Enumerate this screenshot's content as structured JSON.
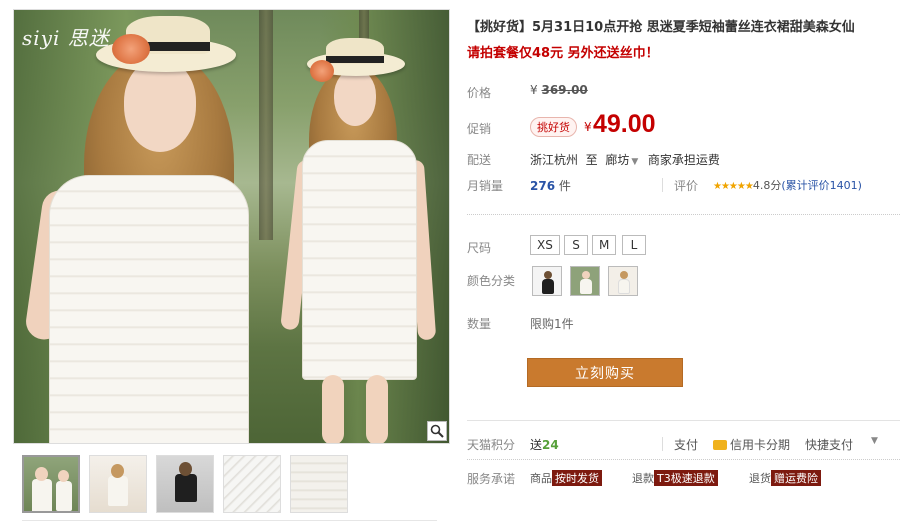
{
  "product": {
    "title": "【挑好货】5月31日10点开抢 思迷夏季短袖蕾丝连衣裙甜美森女仙",
    "subtitle": "请拍套餐仅48元 另外还送丝巾！",
    "brand_logo": "siyi 思迷"
  },
  "price": {
    "label": "价格",
    "currency": "¥",
    "original": "369.00",
    "promo_label": "促销",
    "promo_badge": "挑好货",
    "current": "49.00"
  },
  "shipping": {
    "label": "配送",
    "from": "浙江杭州",
    "to_word": "至",
    "to": "廊坊",
    "fee": "商家承担运费"
  },
  "sales": {
    "label": "月销量",
    "count": "276",
    "unit": "件",
    "rating_label": "评价",
    "stars": "★★★★★",
    "score": "4.8分",
    "review_link": "(累计评价1401)"
  },
  "options": {
    "size_label": "尺码",
    "sizes": [
      "XS",
      "S",
      "M",
      "L"
    ],
    "color_label": "颜色分类",
    "quantity_label": "数量",
    "quantity_limit": "限购1件"
  },
  "buy_button": "立刻购买",
  "footer": {
    "points_label": "天猫积分",
    "points_prefix": "送",
    "points": "24",
    "pay_label": "支付",
    "pay_method": "信用卡分期",
    "quick_pay": "快捷支付",
    "service_label": "服务承诺",
    "service_1_prefix": "商品",
    "service_1_tag": "按时发货",
    "service_2_prefix": "退款",
    "service_2_tag": "T3极速退款",
    "service_3_prefix": "退货",
    "service_3_tag": "赠运费险"
  },
  "icons": [
    "zoom-icon",
    "caret-down-icon",
    "credit-card-icon",
    "star-icon"
  ],
  "colors": {
    "accent_red": "#c40000",
    "buy_button": "#c97a2e",
    "link_blue": "#2953a6"
  }
}
